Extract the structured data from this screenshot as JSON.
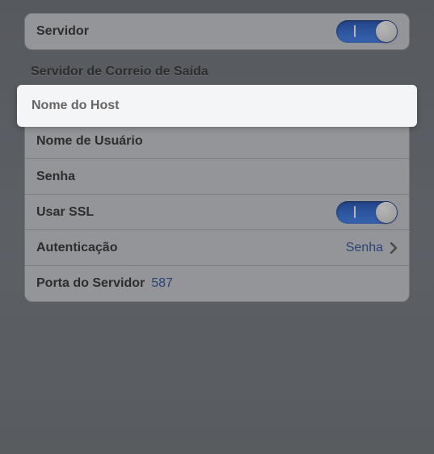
{
  "server_row": {
    "label": "Servidor",
    "on": true
  },
  "outgoing_header": "Servidor de Correio de Saída",
  "rows": {
    "host": {
      "label": "Nome do Host"
    },
    "username": {
      "label": "Nome de Usuário"
    },
    "password": {
      "label": "Senha"
    },
    "ssl": {
      "label": "Usar SSL",
      "on": true
    },
    "auth": {
      "label": "Autenticação",
      "value": "Senha"
    },
    "port": {
      "label": "Porta do Servidor",
      "value": "587"
    }
  }
}
